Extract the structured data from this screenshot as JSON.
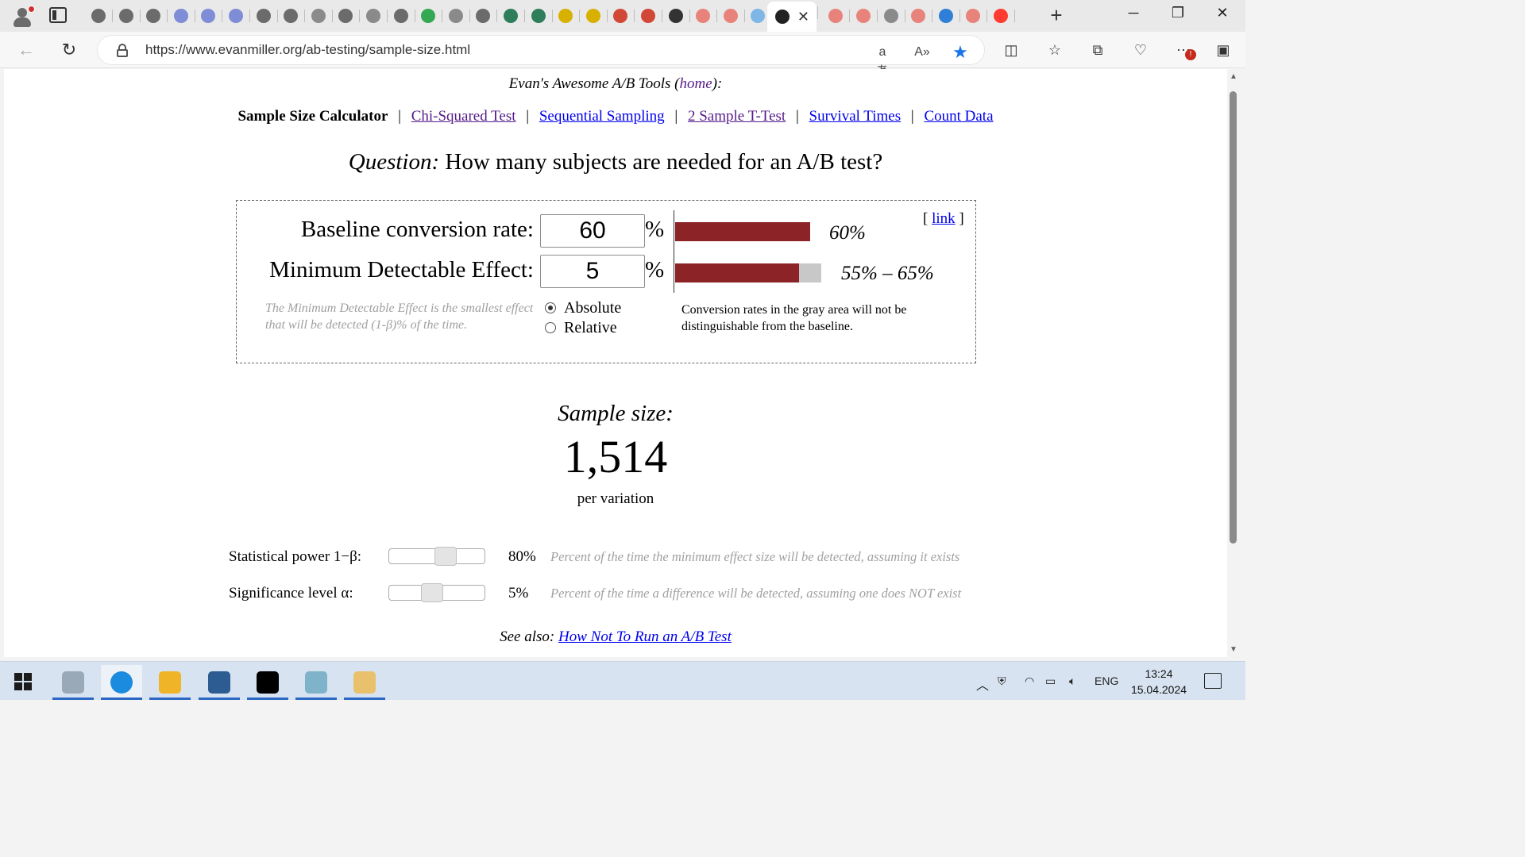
{
  "browser": {
    "url": "https://www.evanmiller.org/ab-testing/sample-size.html",
    "tabs": [
      {
        "icon": "openai-icon",
        "color": "#6b6b6b"
      },
      {
        "icon": "openai-icon",
        "color": "#6b6b6b"
      },
      {
        "icon": "openai-icon",
        "color": "#6b6b6b"
      },
      {
        "icon": "tt-icon",
        "color": "#7f8cd6"
      },
      {
        "icon": "tt-icon",
        "color": "#7f8cd6"
      },
      {
        "icon": "tt-icon",
        "color": "#7f8cd6"
      },
      {
        "icon": "openai-icon",
        "color": "#6b6b6b"
      },
      {
        "icon": "openai-icon",
        "color": "#6b6b6b"
      },
      {
        "icon": "page-icon",
        "color": "#8a8a8a"
      },
      {
        "icon": "openai-icon",
        "color": "#6b6b6b"
      },
      {
        "icon": "page-icon",
        "color": "#8a8a8a"
      },
      {
        "icon": "openai-icon",
        "color": "#6b6b6b"
      },
      {
        "icon": "sheets-icon",
        "color": "#34a853"
      },
      {
        "icon": "page-icon",
        "color": "#8a8a8a"
      },
      {
        "icon": "openai-icon",
        "color": "#6b6b6b"
      },
      {
        "icon": "w-icon",
        "color": "#2e7d5b"
      },
      {
        "icon": "w-icon",
        "color": "#2e7d5b"
      },
      {
        "icon": "m-icon",
        "color": "#d8b000"
      },
      {
        "icon": "m-icon",
        "color": "#d8b000"
      },
      {
        "icon": "gmail-icon",
        "color": "#d14836"
      },
      {
        "icon": "gmail-icon",
        "color": "#d14836"
      },
      {
        "icon": "github-icon",
        "color": "#333333"
      },
      {
        "icon": "yandex-icon",
        "color": "#e8837b"
      },
      {
        "icon": "yandex-icon",
        "color": "#e8837b"
      },
      {
        "icon": "snowflake-icon",
        "color": "#7fb6e6"
      },
      {
        "icon": "cat-icon",
        "color": "#222222"
      },
      {
        "icon": "yandex-icon",
        "color": "#e8837b"
      },
      {
        "icon": "yandex-icon",
        "color": "#e8837b"
      },
      {
        "icon": "window-icon",
        "color": "#8a8a8a"
      },
      {
        "icon": "yandex-icon",
        "color": "#e8837b"
      },
      {
        "icon": "snowflake-icon",
        "color": "#2f7fd8"
      },
      {
        "icon": "yandex-icon",
        "color": "#e8837b"
      },
      {
        "icon": "yandex-icon",
        "color": "#ff3b30"
      }
    ]
  },
  "page": {
    "header_prefix": "Evan's Awesome A/B Tools (",
    "header_link": "home",
    "header_suffix": "):",
    "nav": {
      "current": "Sample Size Calculator",
      "links": [
        "Chi-Squared Test",
        "Sequential Sampling",
        "2 Sample T-Test",
        "Survival Times",
        "Count Data"
      ]
    },
    "question_prefix": "Question:",
    "question_text": "How many subjects are needed for an A/B test?",
    "calc": {
      "baseline_label": "Baseline conversion rate:",
      "baseline_value": "60",
      "mde_label": "Minimum Detectable Effect:",
      "mde_value": "5",
      "percent_sign": "%",
      "baseline_bar_label": "60%",
      "mde_bar_label": "55% – 65%",
      "baseline_rate": 0.6,
      "mde_low": 0.55,
      "mde_high": 0.65,
      "link_open": "[",
      "link_label": "link",
      "link_close": "]",
      "hint": "The Minimum Detectable Effect is the smallest effect that will be detected (1-β)% of the time.",
      "radio_absolute": "Absolute",
      "radio_relative": "Relative",
      "note": "Conversion rates in the gray area will not be distinguishable from the baseline.",
      "bar_color": "#8b2327",
      "gray_color": "#c8c8c8"
    },
    "result": {
      "label": "Sample size:",
      "value": "1,514",
      "unit": "per variation"
    },
    "power": {
      "label": "Statistical power 1−β:",
      "value": "80%",
      "fraction": 0.8,
      "desc": "Percent of the time the minimum effect size will be detected, assuming it exists"
    },
    "significance": {
      "label": "Significance level α:",
      "value": "5%",
      "fraction": 0.05,
      "desc": "Percent of the time a difference will be detected, assuming one does NOT exist"
    },
    "see_also_prefix": "See also:",
    "see_also_link": "How Not To Run an A/B Test"
  },
  "taskbar": {
    "lang": "ENG",
    "time": "13:24",
    "date": "15.04.2024",
    "apps": [
      {
        "icon": "photos-icon",
        "color": "#9aa9b8"
      },
      {
        "icon": "edge-icon",
        "color": "#1b8be0"
      },
      {
        "icon": "file-explorer-icon",
        "color": "#f0b429"
      },
      {
        "icon": "vs-code-like-icon",
        "color": "#2d5c93"
      },
      {
        "icon": "pycharm-icon",
        "color": "#000000"
      },
      {
        "icon": "notes-icon",
        "color": "#7fb3c9"
      },
      {
        "icon": "paint-icon",
        "color": "#e9c16c"
      }
    ]
  }
}
